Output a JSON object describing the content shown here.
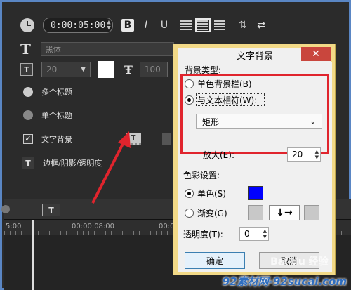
{
  "editor": {
    "timecode": "0:00:05:00",
    "bold_label": "B",
    "italic_label": "I",
    "underline_label": "U",
    "font_name": "黑体",
    "font_size": "20",
    "line_spacing": "100",
    "multi_title": "多个标题",
    "single_title": "单个标题",
    "text_bg_label": "文字背景",
    "border_label": "边框/阴影/透明度",
    "bg_button_label": "T"
  },
  "timeline": {
    "ticks": [
      "5:00",
      "00:00:08:00",
      "00:00:10:00"
    ]
  },
  "dialog": {
    "title": "文字背景",
    "close_label": "✕",
    "bg_type_label": "背景类型:",
    "option_single": "单色背景栏(B)",
    "option_fit": "与文本相符(W):",
    "shape_value": "矩形",
    "zoom_label": "放大(E):",
    "zoom_value": "20",
    "color_settings_label": "色彩设置:",
    "color_single": "单色(S)",
    "color_gradient": "渐变(G)",
    "opacity_label": "透明度(T):",
    "opacity_value": "0",
    "ok_label": "确定",
    "cancel_label": "取消"
  },
  "colors": {
    "single_color": "#0000ff",
    "highlight": "#e0242d",
    "arrow": "#e0242d"
  },
  "watermark": "92素材网-92sucai.com",
  "watermark_overlay": "Bai du 经验"
}
